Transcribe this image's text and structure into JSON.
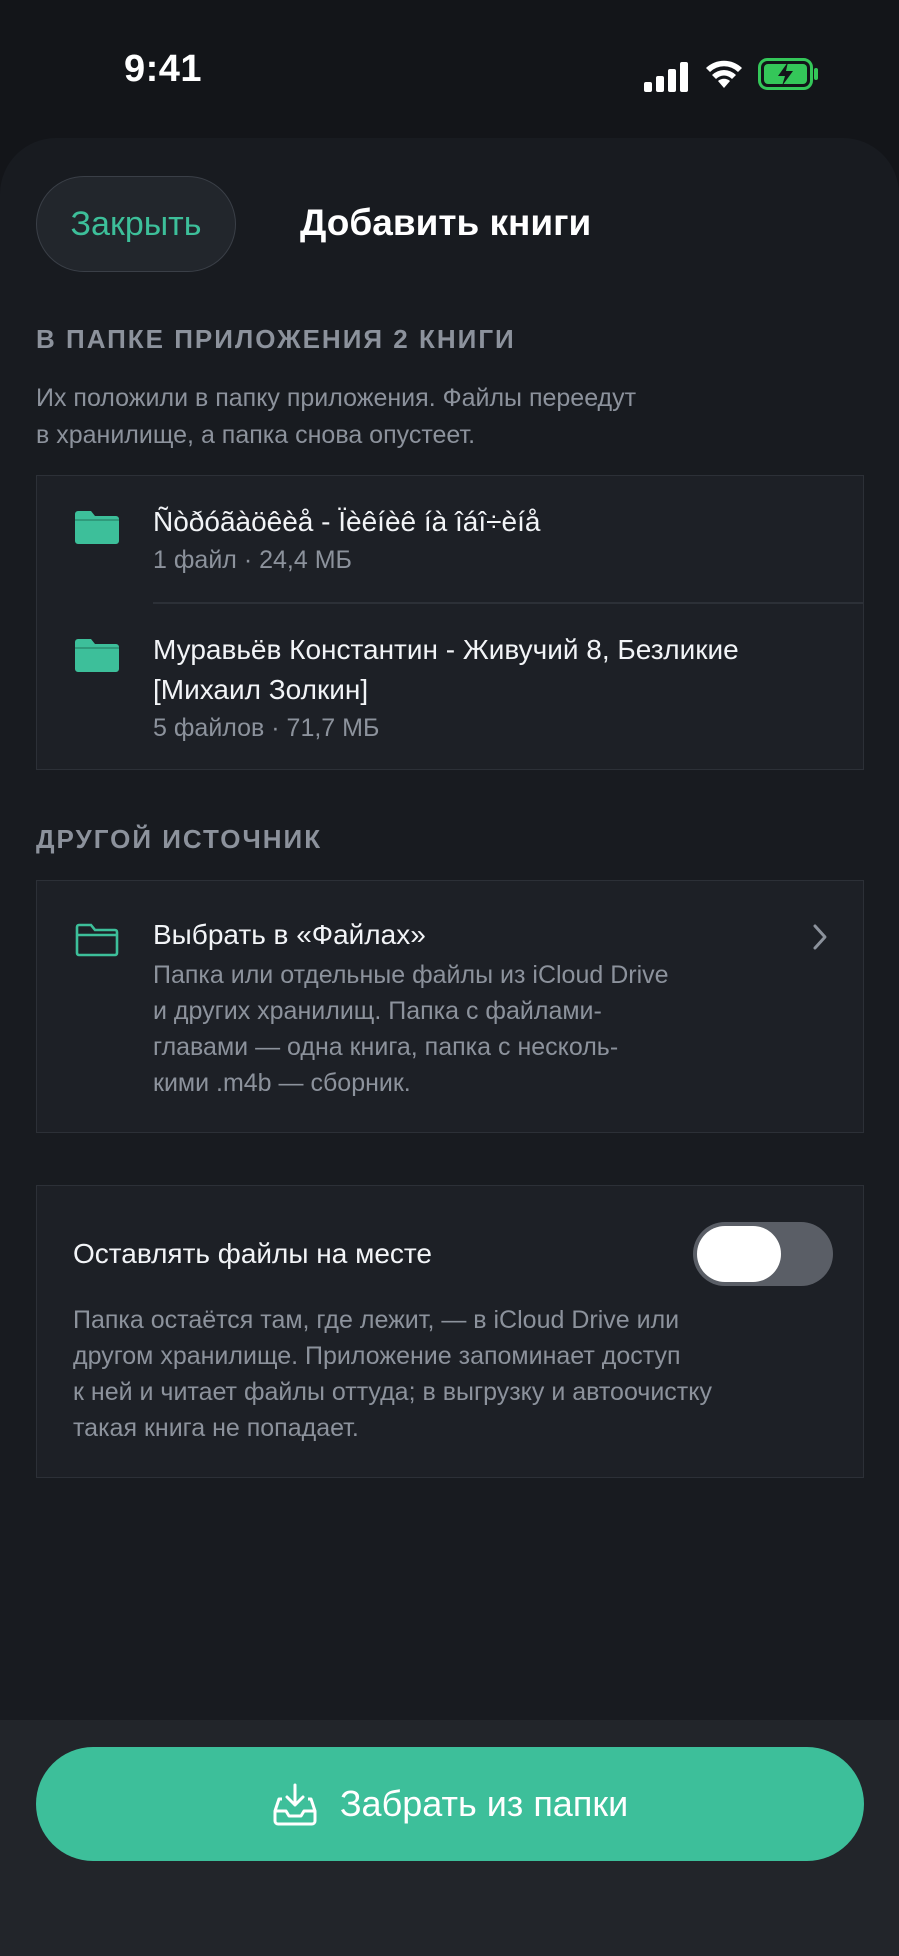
{
  "status": {
    "time": "9:41"
  },
  "header": {
    "close_label": "Закрыть",
    "title": "Добавить книги"
  },
  "inbox": {
    "section_title": "В ПАПКЕ ПРИЛОЖЕНИЯ 2 КНИГИ",
    "description_line1": "Их положили в папку приложения. Файлы переедут",
    "description_line2": "в хранилище, а папка снова опустеет.",
    "items": [
      {
        "title": "Ñòðóãàöêèå - Ïèêíèê íà îáî÷èíå",
        "meta": "1 файл · 24,4 МБ"
      },
      {
        "title_line1": "Муравьёв Константин - Живучий 8, Безликие",
        "title_line2": "[Михаил Золкин]",
        "meta": "5 файлов · 71,7 МБ"
      }
    ]
  },
  "other_source": {
    "section_title": "ДРУГОЙ ИСТОЧНИК",
    "title": "Выбрать в «Файлах»",
    "desc_line1": "Папка или отдельные файлы из iCloud Drive",
    "desc_line2": "и других хранилищ. Папка с файлами-",
    "desc_line3": "главами — одна книга, папка с несколь-",
    "desc_line4": "кими .m4b — сборник."
  },
  "keep_files": {
    "label": "Оставлять файлы на месте",
    "enabled": false,
    "desc_line1": "Папка остаётся там, где лежит, — в iCloud Drive или",
    "desc_line2": "другом хранилище. Приложение запоминает доступ",
    "desc_line3": "к ней и читает файлы оттуда; в выгрузку и автоочистку",
    "desc_line4": "такая книга не попадает."
  },
  "action": {
    "label": "Забрать из папки"
  },
  "colors": {
    "accent": "#3dbf9a",
    "background": "#131519",
    "card": "#1d2026"
  }
}
